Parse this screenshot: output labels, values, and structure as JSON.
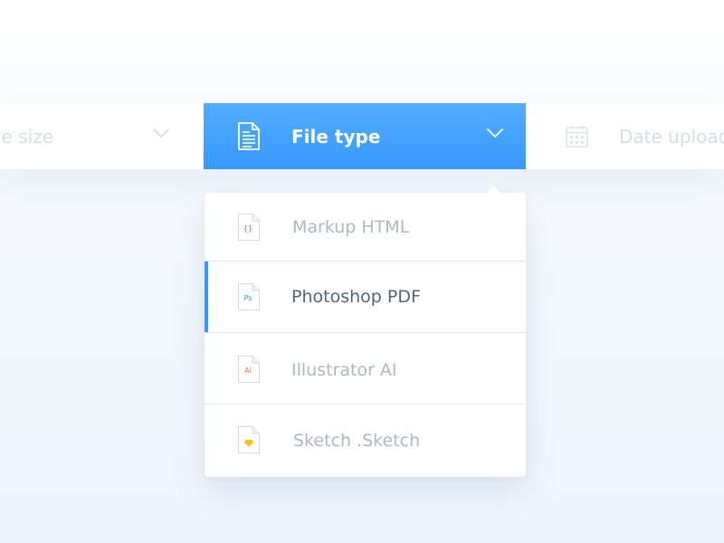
{
  "filter_bar": {
    "file_size": {
      "label": "le size"
    },
    "file_type": {
      "label": "File type",
      "icon": "document-icon",
      "open": true
    },
    "date_uploaded": {
      "label": "Date upload",
      "icon": "calendar-icon"
    }
  },
  "dropdown": {
    "items": [
      {
        "label": "Markup HTML",
        "icon": "html-file-icon",
        "glyph": "{}",
        "glyph_color": "#e0574b",
        "selected": false
      },
      {
        "label": "Photoshop PDF",
        "icon": "photoshop-file-icon",
        "glyph": "Ps",
        "glyph_color": "#2f8ee0",
        "selected": true
      },
      {
        "label": "Illustrator AI",
        "icon": "illustrator-file-icon",
        "glyph": "Ai",
        "glyph_color": "#e8703a",
        "selected": false
      },
      {
        "label": "Sketch .Sketch",
        "icon": "sketch-file-icon",
        "glyph": "",
        "glyph_color": "#f7c21f",
        "selected": false
      }
    ]
  },
  "colors": {
    "accent": "#3799ff",
    "selected_text": "#56627b",
    "muted_text": "#aeb7c8",
    "inactive_filter_text": "#d8dde4"
  }
}
